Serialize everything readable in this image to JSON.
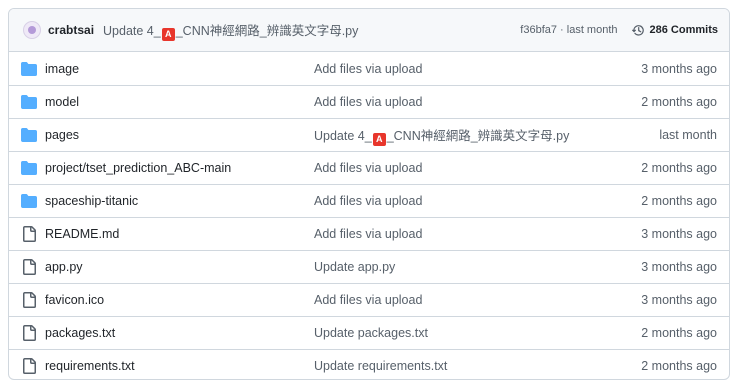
{
  "header": {
    "author": "crabtsai",
    "message_before": "Update 4_",
    "message_emoji": "A",
    "message_after": "_CNN神經網路_辨識英文字母.py",
    "sha_and_time": "f36bfa7 · last month",
    "commits": "286 Commits"
  },
  "colors": {
    "folder": "#54aeff",
    "file_icon": "#57606a",
    "muted": "#57606a"
  },
  "rows": [
    {
      "type": "folder",
      "name": "image",
      "msg": "Add files via upload",
      "age": "3 months ago"
    },
    {
      "type": "folder",
      "name": "model",
      "msg": "Add files via upload",
      "age": "2 months ago"
    },
    {
      "type": "folder",
      "name": "pages",
      "msg_before": "Update 4_",
      "msg_emoji": "A",
      "msg_after": "_CNN神經網路_辨識英文字母.py",
      "age": "last month"
    },
    {
      "type": "folder",
      "name": "project/tset_prediction_ABC-main",
      "msg": "Add files via upload",
      "age": "2 months ago"
    },
    {
      "type": "folder",
      "name": "spaceship-titanic",
      "msg": "Add files via upload",
      "age": "2 months ago"
    },
    {
      "type": "file",
      "name": "README.md",
      "msg": "Add files via upload",
      "age": "3 months ago"
    },
    {
      "type": "file",
      "name": "app.py",
      "msg": "Update app.py",
      "age": "3 months ago"
    },
    {
      "type": "file",
      "name": "favicon.ico",
      "msg": "Add files via upload",
      "age": "3 months ago"
    },
    {
      "type": "file",
      "name": "packages.txt",
      "msg": "Update packages.txt",
      "age": "2 months ago"
    },
    {
      "type": "file",
      "name": "requirements.txt",
      "msg": "Update requirements.txt",
      "age": "2 months ago"
    }
  ]
}
